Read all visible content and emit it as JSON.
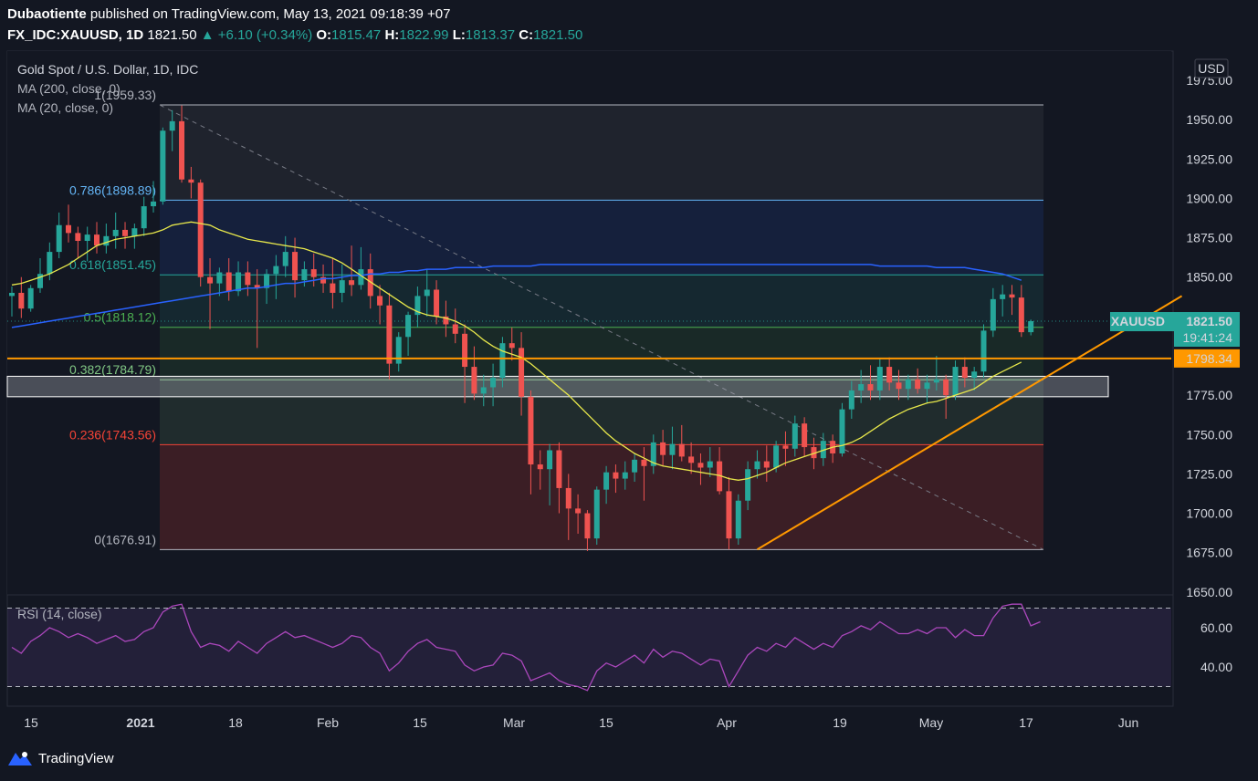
{
  "header": {
    "publisher": "Dubaotiente",
    "published_text": "published on TradingView.com, May 13, 2021 09:18:39 +07",
    "symbol": "FX_IDC:XAUUSD, 1D",
    "last": "1821.50",
    "change": "+6.10 (+0.34%)",
    "o_label": "O:",
    "o_value": "1815.47",
    "h_label": "H:",
    "h_value": "1822.99",
    "l_label": "L:",
    "l_value": "1813.37",
    "c_label": "C:",
    "c_value": "1821.50"
  },
  "legend": {
    "title": "Gold Spot / U.S. Dollar, 1D, IDC",
    "ma200": "MA (200, close, 0)",
    "ma20": "MA (20, close, 0)",
    "rsi": "RSI (14, close)"
  },
  "price_axis": {
    "currency": "USD",
    "ticks": [
      "1975.00",
      "1950.00",
      "1925.00",
      "1900.00",
      "1875.00",
      "1850.00",
      "1825.00",
      "1800.00",
      "1775.00",
      "1750.00",
      "1725.00",
      "1700.00",
      "1675.00",
      "1650.00"
    ],
    "last_symbol": "XAUUSD",
    "last_price": "1821.50",
    "countdown": "19:41:24",
    "hline_label": "1798.34"
  },
  "rsi_axis": {
    "ticks": [
      "60.00",
      "40.00"
    ]
  },
  "time_axis": {
    "labels": [
      "15",
      "2021",
      "18",
      "Feb",
      "15",
      "Mar",
      "15",
      "Apr",
      "19",
      "May",
      "17",
      "Jun"
    ]
  },
  "fib_labels": [
    "1(1959.33)",
    "0.786(1898.89)",
    "0.618(1851.45)",
    "0.5(1818.12)",
    "0.382(1784.79)",
    "0.236(1743.56)",
    "0(1676.91)"
  ],
  "footer": {
    "brand": "TradingView"
  },
  "colors": {
    "up": "#26a69a",
    "down": "#ef5350",
    "ma200": "#2962ff",
    "ma20": "#e8e84b",
    "trend": "#ff9800",
    "rsi": "#ab47bc"
  },
  "chart_data": {
    "type": "candlestick",
    "symbol": "XAUUSD",
    "timeframe": "1D",
    "date_range": [
      "2020-12-11",
      "2021-05-12"
    ],
    "candles": [
      [
        1838,
        1844,
        1825,
        1840
      ],
      [
        1840,
        1850,
        1824,
        1830
      ],
      [
        1830,
        1845,
        1828,
        1843
      ],
      [
        1843,
        1862,
        1840,
        1852
      ],
      [
        1852,
        1872,
        1848,
        1866
      ],
      [
        1866,
        1891,
        1862,
        1883
      ],
      [
        1883,
        1896,
        1872,
        1878
      ],
      [
        1878,
        1882,
        1862,
        1873
      ],
      [
        1873,
        1882,
        1860,
        1877
      ],
      [
        1877,
        1885,
        1865,
        1870
      ],
      [
        1870,
        1884,
        1865,
        1876
      ],
      [
        1876,
        1891,
        1868,
        1880
      ],
      [
        1880,
        1885,
        1868,
        1876
      ],
      [
        1876,
        1884,
        1868,
        1881
      ],
      [
        1881,
        1901,
        1876,
        1895
      ],
      [
        1895,
        1911,
        1891,
        1898
      ],
      [
        1898,
        1945,
        1896,
        1943
      ],
      [
        1943,
        1956,
        1930,
        1949
      ],
      [
        1949,
        1959,
        1910,
        1912
      ],
      [
        1912,
        1920,
        1900,
        1910
      ],
      [
        1910,
        1912,
        1844,
        1850
      ],
      [
        1850,
        1862,
        1817,
        1846
      ],
      [
        1846,
        1856,
        1838,
        1853
      ],
      [
        1853,
        1862,
        1835,
        1841
      ],
      [
        1841,
        1860,
        1838,
        1853
      ],
      [
        1853,
        1860,
        1838,
        1845
      ],
      [
        1845,
        1855,
        1805,
        1843
      ],
      [
        1843,
        1855,
        1833,
        1852
      ],
      [
        1852,
        1864,
        1836,
        1857
      ],
      [
        1857,
        1876,
        1850,
        1866
      ],
      [
        1866,
        1875,
        1837,
        1848
      ],
      [
        1848,
        1860,
        1844,
        1855
      ],
      [
        1855,
        1865,
        1844,
        1850
      ],
      [
        1850,
        1858,
        1840,
        1846
      ],
      [
        1846,
        1862,
        1830,
        1840
      ],
      [
        1840,
        1858,
        1834,
        1848
      ],
      [
        1848,
        1870,
        1838,
        1845
      ],
      [
        1845,
        1869,
        1842,
        1855
      ],
      [
        1855,
        1865,
        1830,
        1838
      ],
      [
        1838,
        1845,
        1820,
        1832
      ],
      [
        1832,
        1840,
        1785,
        1795
      ],
      [
        1795,
        1815,
        1790,
        1812
      ],
      [
        1812,
        1828,
        1800,
        1826
      ],
      [
        1826,
        1844,
        1818,
        1838
      ],
      [
        1838,
        1855,
        1825,
        1842
      ],
      [
        1842,
        1848,
        1820,
        1825
      ],
      [
        1825,
        1835,
        1812,
        1820
      ],
      [
        1820,
        1830,
        1808,
        1814
      ],
      [
        1814,
        1820,
        1770,
        1793
      ],
      [
        1793,
        1806,
        1772,
        1776
      ],
      [
        1776,
        1788,
        1768,
        1780
      ],
      [
        1780,
        1795,
        1768,
        1786
      ],
      [
        1786,
        1812,
        1780,
        1808
      ],
      [
        1808,
        1818,
        1797,
        1805
      ],
      [
        1805,
        1815,
        1762,
        1774
      ],
      [
        1774,
        1778,
        1712,
        1731
      ],
      [
        1731,
        1740,
        1715,
        1728
      ],
      [
        1728,
        1744,
        1705,
        1740
      ],
      [
        1740,
        1745,
        1700,
        1716
      ],
      [
        1716,
        1725,
        1683,
        1703
      ],
      [
        1703,
        1712,
        1687,
        1700
      ],
      [
        1700,
        1702,
        1676,
        1684
      ],
      [
        1684,
        1717,
        1680,
        1715
      ],
      [
        1715,
        1730,
        1706,
        1726
      ],
      [
        1726,
        1731,
        1713,
        1722
      ],
      [
        1722,
        1733,
        1715,
        1726
      ],
      [
        1726,
        1738,
        1720,
        1734
      ],
      [
        1734,
        1742,
        1708,
        1730
      ],
      [
        1730,
        1750,
        1725,
        1745
      ],
      [
        1745,
        1753,
        1730,
        1737
      ],
      [
        1737,
        1755,
        1728,
        1744
      ],
      [
        1744,
        1756,
        1733,
        1736
      ],
      [
        1736,
        1745,
        1725,
        1732
      ],
      [
        1732,
        1738,
        1718,
        1729
      ],
      [
        1729,
        1742,
        1723,
        1733
      ],
      [
        1733,
        1742,
        1712,
        1714
      ],
      [
        1714,
        1723,
        1677,
        1684
      ],
      [
        1684,
        1712,
        1680,
        1708
      ],
      [
        1708,
        1733,
        1702,
        1728
      ],
      [
        1728,
        1740,
        1722,
        1733
      ],
      [
        1733,
        1743,
        1720,
        1729
      ],
      [
        1729,
        1746,
        1726,
        1743
      ],
      [
        1743,
        1752,
        1730,
        1741
      ],
      [
        1741,
        1762,
        1736,
        1757
      ],
      [
        1757,
        1761,
        1736,
        1742
      ],
      [
        1742,
        1748,
        1728,
        1735
      ],
      [
        1735,
        1751,
        1730,
        1746
      ],
      [
        1746,
        1750,
        1732,
        1738
      ],
      [
        1738,
        1770,
        1736,
        1766
      ],
      [
        1766,
        1784,
        1760,
        1778
      ],
      [
        1778,
        1791,
        1770,
        1782
      ],
      [
        1782,
        1794,
        1772,
        1778
      ],
      [
        1778,
        1798,
        1772,
        1793
      ],
      [
        1793,
        1799,
        1778,
        1783
      ],
      [
        1783,
        1791,
        1772,
        1779
      ],
      [
        1779,
        1788,
        1772,
        1785
      ],
      [
        1785,
        1792,
        1776,
        1779
      ],
      [
        1779,
        1788,
        1770,
        1783
      ],
      [
        1783,
        1800,
        1778,
        1785
      ],
      [
        1785,
        1788,
        1760,
        1775
      ],
      [
        1775,
        1797,
        1772,
        1793
      ],
      [
        1793,
        1799,
        1780,
        1786
      ],
      [
        1786,
        1793,
        1778,
        1790
      ],
      [
        1790,
        1820,
        1786,
        1816
      ],
      [
        1816,
        1843,
        1812,
        1836
      ],
      [
        1836,
        1845,
        1825,
        1839
      ],
      [
        1839,
        1845,
        1826,
        1837
      ],
      [
        1837,
        1845,
        1812,
        1815
      ],
      [
        1815,
        1823,
        1813,
        1822
      ]
    ],
    "ma20": [
      1845,
      1846,
      1848,
      1850,
      1852,
      1855,
      1858,
      1862,
      1866,
      1870,
      1872,
      1874,
      1875,
      1876,
      1877,
      1878,
      1880,
      1883,
      1884,
      1885,
      1884,
      1883,
      1880,
      1878,
      1876,
      1874,
      1873,
      1872,
      1871,
      1870,
      1869,
      1868,
      1866,
      1864,
      1862,
      1859,
      1855,
      1851,
      1847,
      1843,
      1839,
      1835,
      1831,
      1828,
      1826,
      1825,
      1824,
      1822,
      1819,
      1815,
      1810,
      1806,
      1803,
      1801,
      1799,
      1795,
      1790,
      1785,
      1780,
      1775,
      1769,
      1763,
      1757,
      1751,
      1746,
      1742,
      1738,
      1735,
      1732,
      1730,
      1729,
      1728,
      1727,
      1726,
      1725,
      1724,
      1722,
      1721,
      1722,
      1724,
      1726,
      1729,
      1732,
      1734,
      1736,
      1738,
      1740,
      1742,
      1743,
      1745,
      1748,
      1752,
      1756,
      1760,
      1763,
      1766,
      1768,
      1770,
      1771,
      1773,
      1775,
      1777,
      1779,
      1783,
      1787,
      1790,
      1793,
      1796
    ],
    "ma200": [
      1818,
      1819,
      1820,
      1821,
      1822,
      1823,
      1824,
      1825,
      1826,
      1827,
      1828,
      1829,
      1830,
      1831,
      1832,
      1833,
      1834,
      1835,
      1836,
      1837,
      1838,
      1839,
      1840,
      1841,
      1842,
      1843,
      1843,
      1844,
      1845,
      1846,
      1846,
      1847,
      1848,
      1849,
      1849,
      1850,
      1851,
      1851,
      1852,
      1852,
      1853,
      1853,
      1854,
      1854,
      1855,
      1855,
      1855,
      1856,
      1856,
      1856,
      1856,
      1857,
      1857,
      1857,
      1857,
      1857,
      1858,
      1858,
      1858,
      1858,
      1858,
      1858,
      1858,
      1858,
      1858,
      1858,
      1858,
      1858,
      1858,
      1858,
      1858,
      1858,
      1858,
      1858,
      1858,
      1858,
      1858,
      1858,
      1858,
      1858,
      1858,
      1858,
      1858,
      1858,
      1858,
      1858,
      1858,
      1858,
      1858,
      1858,
      1858,
      1858,
      1857,
      1857,
      1857,
      1857,
      1857,
      1857,
      1856,
      1856,
      1856,
      1856,
      1855,
      1854,
      1853,
      1852,
      1850,
      1848
    ],
    "rsi": [
      50,
      47,
      53,
      56,
      60,
      58,
      55,
      57,
      55,
      52,
      54,
      56,
      53,
      54,
      58,
      60,
      68,
      71,
      72,
      58,
      50,
      52,
      51,
      48,
      53,
      50,
      47,
      52,
      55,
      58,
      55,
      56,
      54,
      52,
      50,
      52,
      56,
      55,
      50,
      47,
      38,
      42,
      48,
      52,
      54,
      50,
      49,
      48,
      41,
      38,
      40,
      41,
      47,
      46,
      43,
      33,
      35,
      37,
      33,
      31,
      30,
      28,
      38,
      42,
      40,
      43,
      46,
      42,
      49,
      45,
      48,
      47,
      44,
      41,
      44,
      43,
      30,
      38,
      46,
      50,
      48,
      52,
      50,
      55,
      52,
      49,
      52,
      50,
      56,
      58,
      61,
      59,
      63,
      60,
      57,
      57,
      59,
      57,
      60,
      60,
      55,
      59,
      56,
      56,
      65,
      71,
      72,
      72,
      61,
      63
    ],
    "fibonacci": {
      "levels": [
        {
          "ratio": 1,
          "price": 1959.33,
          "color": "#b2b5be"
        },
        {
          "ratio": 0.786,
          "price": 1898.89,
          "color": "#64b5f6"
        },
        {
          "ratio": 0.618,
          "price": 1851.45,
          "color": "#26a69a"
        },
        {
          "ratio": 0.5,
          "price": 1818.12,
          "color": "#4caf50"
        },
        {
          "ratio": 0.382,
          "price": 1784.79,
          "color": "#81c784"
        },
        {
          "ratio": 0.236,
          "price": 1743.56,
          "color": "#f44336"
        },
        {
          "ratio": 0,
          "price": 1676.91,
          "color": "#b2b5be"
        }
      ]
    },
    "horizontal_line": 1798.34,
    "support_zone": [
      1774,
      1787
    ],
    "trendline": [
      [
        "2021-03-31",
        1677
      ],
      [
        "2021-06-02",
        1838
      ]
    ],
    "ylim": [
      1641,
      1978
    ],
    "rsi_bands": [
      70,
      30
    ]
  }
}
